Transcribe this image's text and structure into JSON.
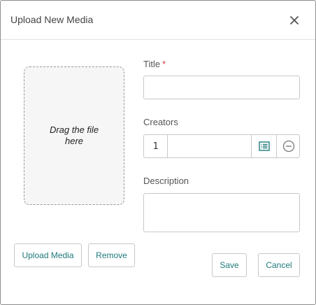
{
  "dialog": {
    "title": "Upload New Media",
    "close_icon": "close-icon"
  },
  "dropzone": {
    "text": "Drag the file here"
  },
  "form": {
    "title_label": "Title",
    "title_required_marker": "*",
    "title_value": "",
    "creators_label": "Creators",
    "creators_index": "1",
    "creators_value": "",
    "creators_list_icon": "list-icon",
    "creators_remove_icon": "minus-circle-icon",
    "description_label": "Description",
    "description_value": ""
  },
  "buttons": {
    "upload_media": "Upload Media",
    "remove": "Remove",
    "save": "Save",
    "cancel": "Cancel"
  },
  "colors": {
    "accent": "#1f7a7a",
    "required": "#d9363e",
    "border": "#c8c8c8"
  }
}
